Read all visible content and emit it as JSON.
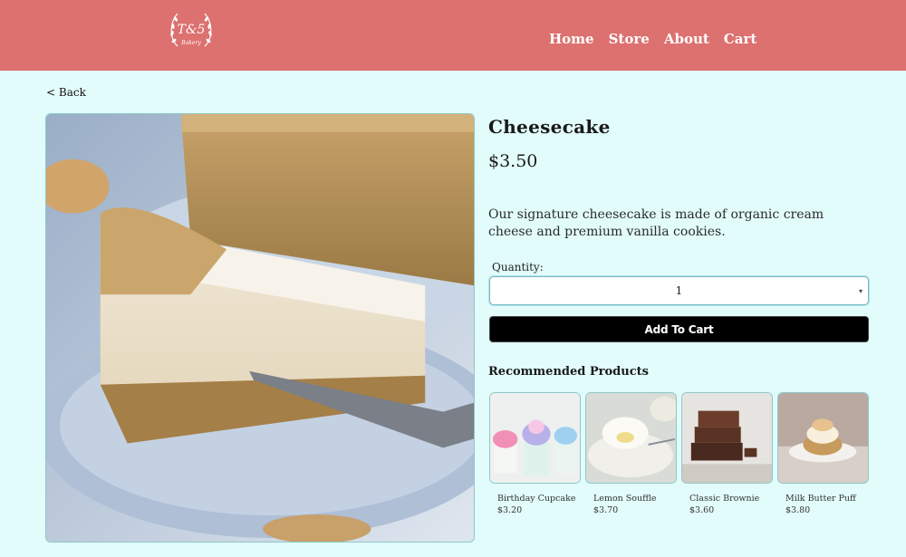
{
  "brand": {
    "logo_monogram": "T&5",
    "logo_subtext": "Bakery"
  },
  "nav": {
    "items": [
      {
        "label": "Home"
      },
      {
        "label": "Store"
      },
      {
        "label": "About"
      },
      {
        "label": "Cart"
      }
    ]
  },
  "back_label": "< Back",
  "product": {
    "name": "Cheesecake",
    "price": "$3.50",
    "description": "Our signature cheesecake is made of organic cream cheese and premium vanilla cookies.",
    "quantity_label": "Quantity:",
    "quantity_value": "1",
    "add_to_cart_label": "Add To Cart"
  },
  "recommended": {
    "title": "Recommended Products",
    "items": [
      {
        "name": "Birthday Cupcake",
        "price": "$3.20"
      },
      {
        "name": "Lemon Souffle",
        "price": "$3.70"
      },
      {
        "name": "Classic Brownie",
        "price": "$3.60"
      },
      {
        "name": "Milk Butter Puff",
        "price": "$3.80"
      }
    ]
  }
}
